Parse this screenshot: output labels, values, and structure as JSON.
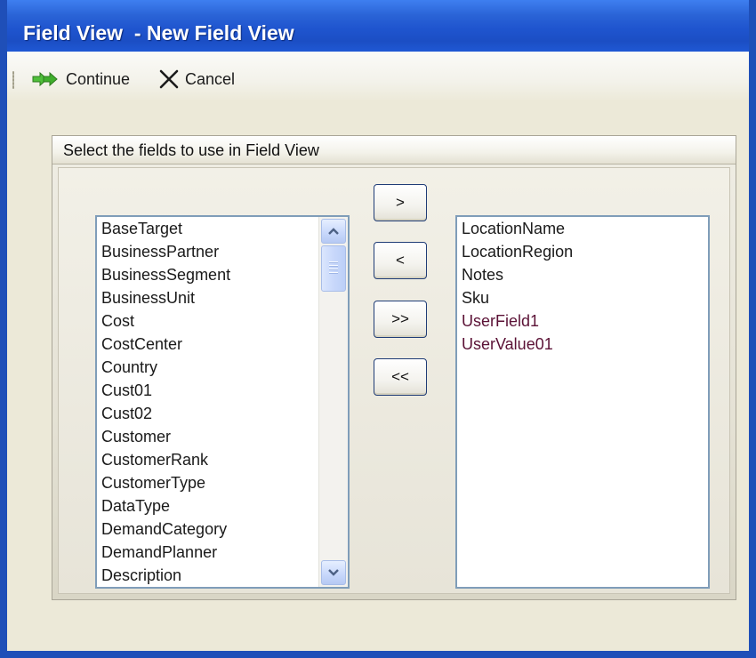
{
  "window": {
    "title": "Field View  - New Field View"
  },
  "toolbar": {
    "continue_label": "Continue",
    "cancel_label": "Cancel"
  },
  "panel": {
    "title": "Select the fields to use in Field View"
  },
  "available_fields": [
    "BaseTarget",
    "BusinessPartner",
    "BusinessSegment",
    "BusinessUnit",
    "Cost",
    "CostCenter",
    "Country",
    "Cust01",
    "Cust02",
    "Customer",
    "CustomerRank",
    "CustomerType",
    "DataType",
    "DemandCategory",
    "DemandPlanner",
    "Description"
  ],
  "selected_fields": [
    "LocationName",
    "LocationRegion",
    "Notes",
    "Sku",
    "UserField1",
    "UserValue01"
  ],
  "move_buttons": {
    "add": ">",
    "remove": "<",
    "add_all": ">>",
    "remove_all": "<<"
  },
  "icons": {
    "continue": "double-arrow-right-icon",
    "cancel": "x-icon",
    "scroll_up": "chevron-up-icon",
    "scroll_down": "chevron-down-icon"
  },
  "colors": {
    "titlebar": "#2459d4",
    "window_border": "#1f4fb8",
    "continue_icon": "#2e9a22",
    "listbox_border": "#7f9db9",
    "scrollbar_button": "#c7d7fb"
  }
}
